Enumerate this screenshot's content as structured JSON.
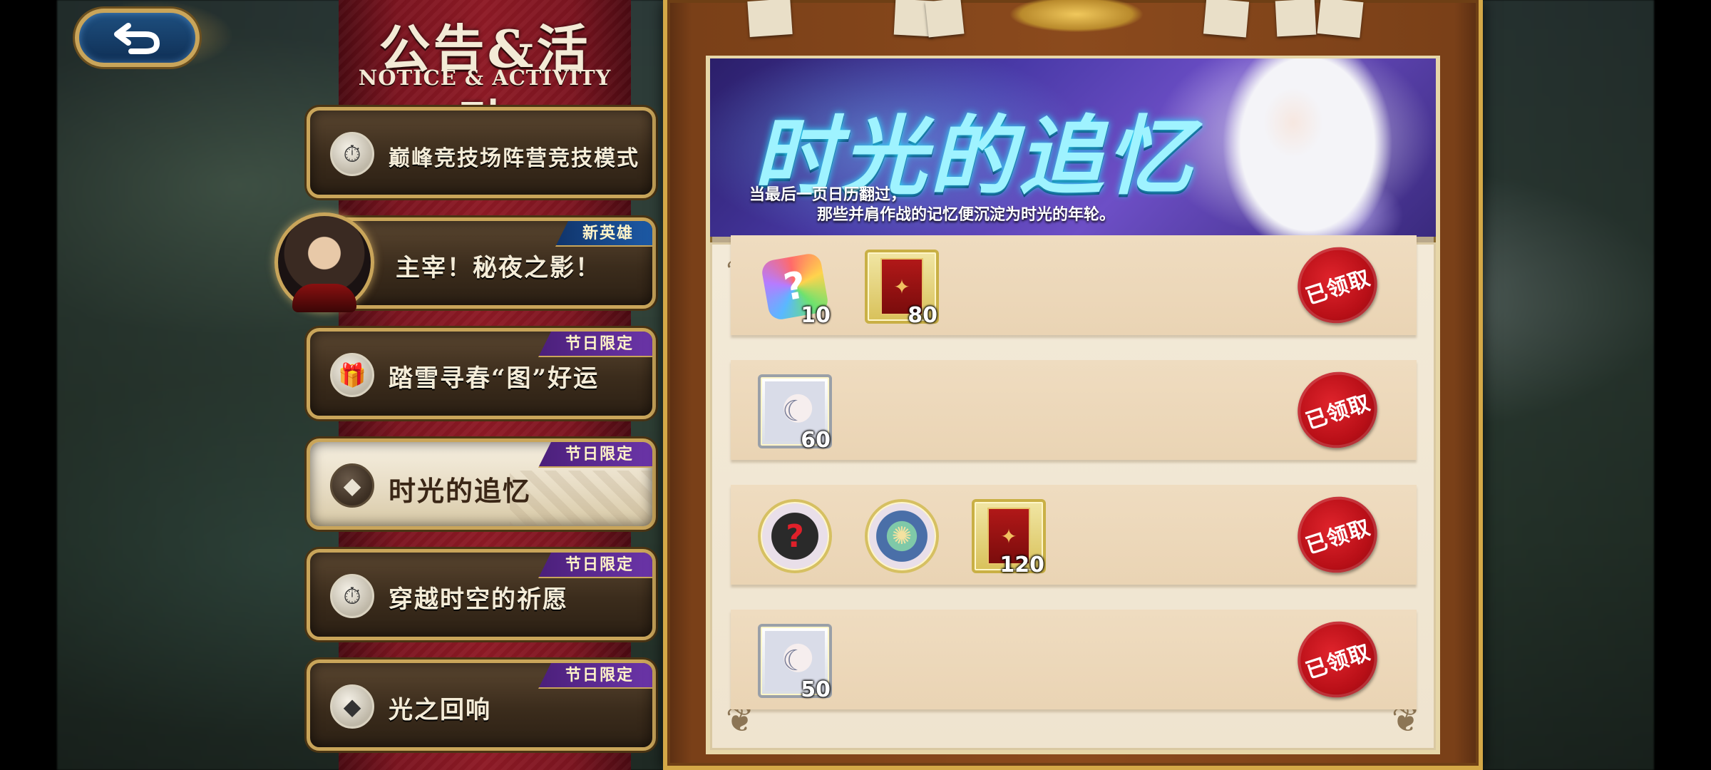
{
  "header": {
    "title": "公告&活动",
    "subtitle": "NOTICE & ACTIVITY"
  },
  "menu": {
    "items": [
      {
        "label": "巅峰竞技场阵营竞技模式",
        "tag": "",
        "icon": "stopwatch-icon"
      },
      {
        "label": "主宰！秘夜之影！",
        "tag": "新英雄",
        "icon": "hero-avatar"
      },
      {
        "label": "踏雪寻春“图”好运",
        "tag": "节日限定",
        "icon": "gift-icon"
      },
      {
        "label": "时光的追忆",
        "tag": "节日限定",
        "icon": "crystal-icon",
        "active": true
      },
      {
        "label": "穿越时空的祈愿",
        "tag": "节日限定",
        "icon": "stopwatch-icon"
      },
      {
        "label": "光之回响",
        "tag": "节日限定",
        "icon": "crystal-icon"
      }
    ]
  },
  "banner": {
    "title": "时光的追忆",
    "caption_line1": "当最后一页日历翻过，",
    "caption_line2": "那些并肩作战的记忆便沉淀为时光的年轮。"
  },
  "rewards": {
    "rows": [
      {
        "items": [
          {
            "icon": "puzzle-mystery-icon",
            "qty": "10"
          },
          {
            "icon": "red-card-icon",
            "qty": "80"
          }
        ],
        "status": "已领取"
      },
      {
        "items": [
          {
            "icon": "hero-portrait-icon",
            "qty": "60"
          }
        ],
        "status": "已领取"
      },
      {
        "items": [
          {
            "icon": "mystery-bag-icon",
            "qty": ""
          },
          {
            "icon": "orb-emblem-icon",
            "qty": ""
          },
          {
            "icon": "red-card-icon",
            "qty": "120"
          }
        ],
        "status": "已领取"
      },
      {
        "items": [
          {
            "icon": "hero-portrait-icon",
            "qty": "50"
          }
        ],
        "status": "已领取"
      }
    ]
  },
  "colors": {
    "frame_gold": "#d4a847",
    "ribbon_red": "#8e1a25",
    "tag_purple": "#6b35a8",
    "tag_blue": "#1d5aa6",
    "stamp_red": "#c8141c"
  }
}
